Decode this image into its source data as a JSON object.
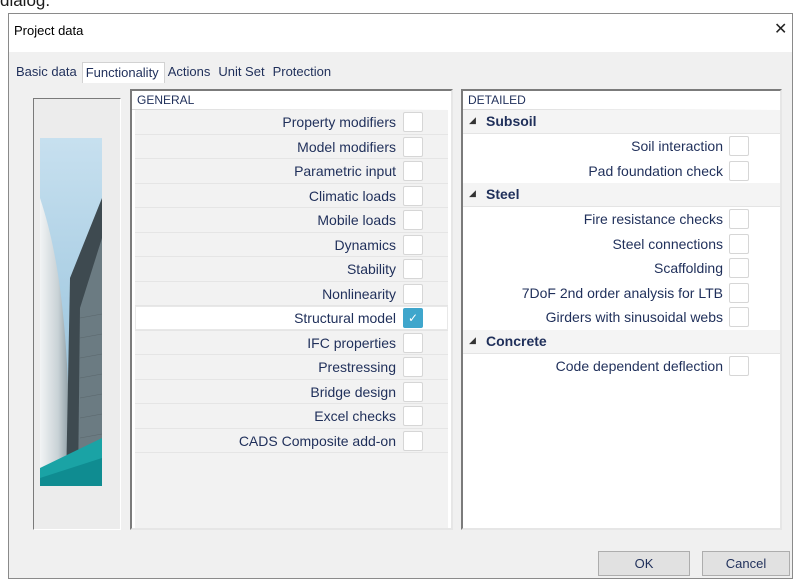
{
  "fragment_text": "dialog.",
  "window": {
    "title": "Project data",
    "close_glyph": "✕"
  },
  "tabs": [
    {
      "label": "Basic data",
      "active": false
    },
    {
      "label": "Functionality",
      "active": true
    },
    {
      "label": "Actions",
      "active": false
    },
    {
      "label": "Unit Set",
      "active": false
    },
    {
      "label": "Protection",
      "active": false
    }
  ],
  "general": {
    "header": "GENERAL",
    "items": [
      {
        "label": "Property modifiers",
        "checked": false
      },
      {
        "label": "Model modifiers",
        "checked": false
      },
      {
        "label": "Parametric input",
        "checked": false
      },
      {
        "label": "Climatic loads",
        "checked": false
      },
      {
        "label": "Mobile loads",
        "checked": false
      },
      {
        "label": "Dynamics",
        "checked": false
      },
      {
        "label": "Stability",
        "checked": false
      },
      {
        "label": "Nonlinearity",
        "checked": false
      },
      {
        "label": "Structural model",
        "checked": true
      },
      {
        "label": "IFC properties",
        "checked": false
      },
      {
        "label": "Prestressing",
        "checked": false
      },
      {
        "label": "Bridge design",
        "checked": false
      },
      {
        "label": "Excel checks",
        "checked": false
      },
      {
        "label": "CADS Composite add-on",
        "checked": false
      }
    ]
  },
  "detailed": {
    "header": "DETAILED",
    "groups": [
      {
        "name": "Subsoil",
        "items": [
          {
            "label": "Soil interaction",
            "checked": false
          },
          {
            "label": "Pad foundation check",
            "checked": false
          }
        ]
      },
      {
        "name": "Steel",
        "items": [
          {
            "label": "Fire resistance checks",
            "checked": false
          },
          {
            "label": "Steel connections",
            "checked": false
          },
          {
            "label": "Scaffolding",
            "checked": false
          },
          {
            "label": "7DoF 2nd order analysis for LTB",
            "checked": false
          },
          {
            "label": "Girders with sinusoidal webs",
            "checked": false
          }
        ]
      },
      {
        "name": "Concrete",
        "items": [
          {
            "label": "Code dependent deflection",
            "checked": false
          }
        ]
      }
    ]
  },
  "buttons": {
    "ok": "OK",
    "cancel": "Cancel"
  },
  "colors": {
    "accent_check": "#3fa6cc",
    "text": "#1f2f5a"
  }
}
